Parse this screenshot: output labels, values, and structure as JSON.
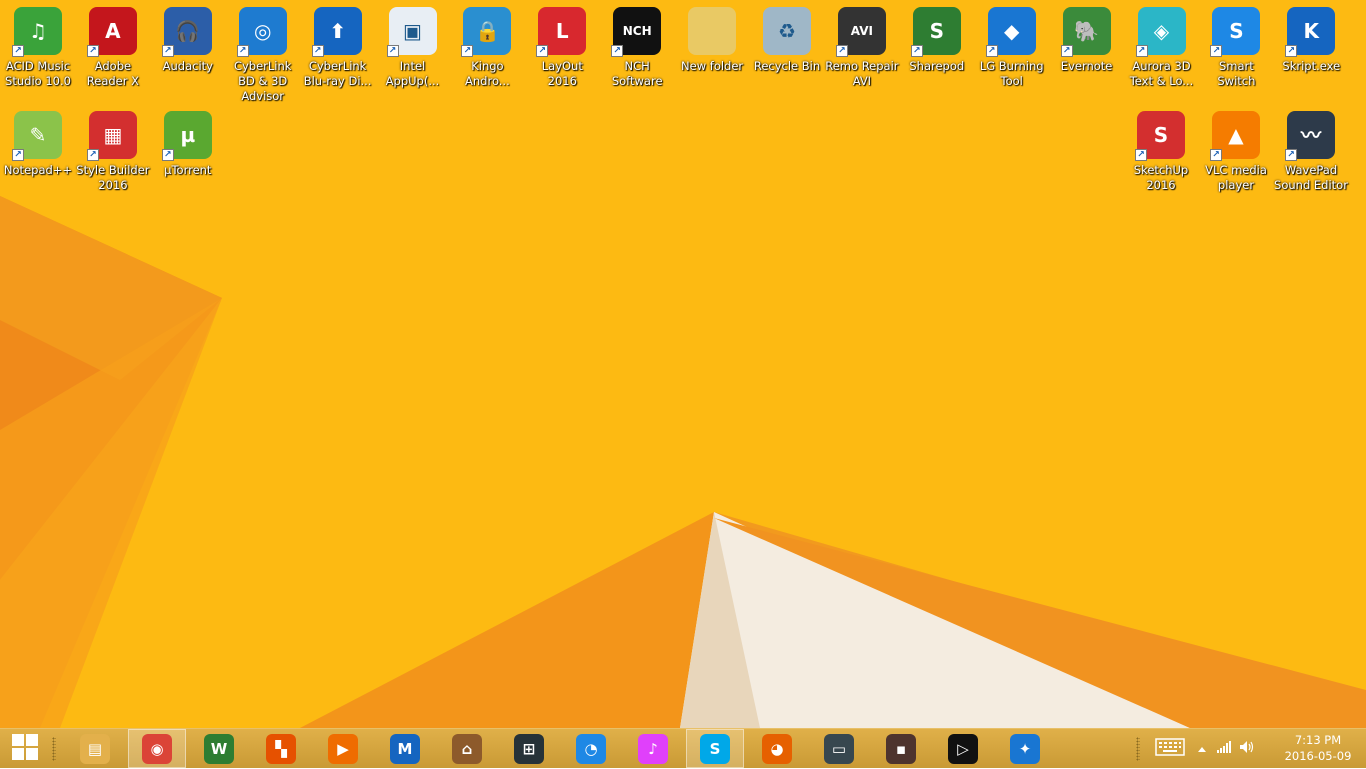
{
  "desktop": {
    "icons": [
      {
        "label": "ACID Music Studio 10.0",
        "icon": "acid-music-icon",
        "glyph": "♫",
        "color": "#3aa33a"
      },
      {
        "label": "Adobe Reader X",
        "icon": "adobe-reader-icon",
        "glyph": "A",
        "color": "#c4161c"
      },
      {
        "label": "Audacity",
        "icon": "audacity-icon",
        "glyph": "🎧",
        "color": "#2c5ea8"
      },
      {
        "label": "CyberLink BD & 3D Advisor",
        "icon": "cyberlink-bd-advisor-icon",
        "glyph": "◎",
        "color": "#1e7bd0"
      },
      {
        "label": "CyberLink Blu-ray Di...",
        "icon": "cyberlink-bluray-icon",
        "glyph": "⬆",
        "color": "#1565c0"
      },
      {
        "label": "Intel AppUp(...",
        "icon": "intel-appup-icon",
        "glyph": "▣",
        "color": "#e8eef4"
      },
      {
        "label": "Kingo Andro...",
        "icon": "kingo-android-icon",
        "glyph": "🔒",
        "color": "#2a8fd0"
      },
      {
        "label": "LayOut 2016",
        "icon": "layout-icon",
        "glyph": "L",
        "color": "#d8282e"
      },
      {
        "label": "NCH Software",
        "icon": "nch-software-icon",
        "glyph": "NCH",
        "color": "#111111"
      },
      {
        "label": "New folder",
        "icon": "folder-icon",
        "glyph": "",
        "color": "#e9c964"
      },
      {
        "label": "Recycle Bin",
        "icon": "recycle-bin-icon",
        "glyph": "♻",
        "color": "#9fb7c7"
      },
      {
        "label": "Remo Repair AVI",
        "icon": "remo-repair-avi-icon",
        "glyph": "AVI",
        "color": "#333333"
      },
      {
        "label": "Sharepod",
        "icon": "sharepod-icon",
        "glyph": "S",
        "color": "#2e7d32"
      },
      {
        "label": "LG Burning Tool",
        "icon": "lg-burning-tool-icon",
        "glyph": "◆",
        "color": "#1976d2"
      },
      {
        "label": "Evernote",
        "icon": "evernote-icon",
        "glyph": "🐘",
        "color": "#3b8b3b"
      },
      {
        "label": "Aurora 3D Text & Lo...",
        "icon": "aurora-3d-icon",
        "glyph": "◈",
        "color": "#2bb6c7"
      },
      {
        "label": "Smart Switch",
        "icon": "smart-switch-icon",
        "glyph": "S",
        "color": "#1e88e5"
      },
      {
        "label": "Skript.exe",
        "icon": "skript-icon",
        "glyph": "K",
        "color": "#1565c0"
      },
      {
        "label": "Notepad++",
        "icon": "notepad-plus-plus-icon",
        "glyph": "✎",
        "color": "#8bc34a"
      },
      {
        "label": "Style Builder 2016",
        "icon": "style-builder-icon",
        "glyph": "▦",
        "color": "#d32f2f"
      },
      {
        "label": "µTorrent",
        "icon": "utorrent-icon",
        "glyph": "µ",
        "color": "#5aa830"
      },
      {
        "label": "SketchUp 2016",
        "icon": "sketchup-icon",
        "glyph": "S",
        "color": "#d32f2f"
      },
      {
        "label": "VLC media player",
        "icon": "vlc-icon",
        "glyph": "▲",
        "color": "#f57c00"
      },
      {
        "label": "WavePad Sound Editor",
        "icon": "wavepad-icon",
        "glyph": "〰",
        "color": "#2d3a4a"
      }
    ]
  },
  "taskbar": {
    "start_icon": "windows-start-icon",
    "apps": [
      {
        "name": "file-explorer",
        "icon": "file-explorer-icon",
        "glyph": "▤",
        "color": "#e3b04b",
        "active": false
      },
      {
        "name": "chrome",
        "icon": "chrome-icon",
        "glyph": "◉",
        "color": "#db4437",
        "active": true
      },
      {
        "name": "wondershare",
        "icon": "wondershare-icon",
        "glyph": "W",
        "color": "#2e7d32",
        "active": false
      },
      {
        "name": "colorful-app",
        "icon": "colorful-app-icon",
        "glyph": "▚",
        "color": "#e65100",
        "active": false
      },
      {
        "name": "video-player",
        "icon": "video-player-icon",
        "glyph": "▶",
        "color": "#ef6c00",
        "active": false
      },
      {
        "name": "malwarebytes",
        "icon": "malwarebytes-icon",
        "glyph": "M",
        "color": "#1565c0",
        "active": false
      },
      {
        "name": "library",
        "icon": "library-icon",
        "glyph": "⌂",
        "color": "#8d5a2b",
        "active": false
      },
      {
        "name": "film-app",
        "icon": "film-app-icon",
        "glyph": "⊞",
        "color": "#263238",
        "active": false
      },
      {
        "name": "bird-app",
        "icon": "bird-app-icon",
        "glyph": "◔",
        "color": "#1e88e5",
        "active": false
      },
      {
        "name": "itunes",
        "icon": "itunes-icon",
        "glyph": "♪",
        "color": "#e040fb",
        "active": false
      },
      {
        "name": "skype",
        "icon": "skype-icon",
        "glyph": "S",
        "color": "#00a8e8",
        "active": true
      },
      {
        "name": "firefox",
        "icon": "firefox-icon",
        "glyph": "◕",
        "color": "#e66000",
        "active": false
      },
      {
        "name": "remote-desktop",
        "icon": "remote-desktop-icon",
        "glyph": "▭",
        "color": "#37474f",
        "active": false
      },
      {
        "name": "hypercam",
        "icon": "hypercam-icon",
        "glyph": "▪",
        "color": "#4e342e",
        "active": false
      },
      {
        "name": "media-player",
        "icon": "media-player-icon",
        "glyph": "▷",
        "color": "#111111",
        "active": false
      },
      {
        "name": "safari",
        "icon": "safari-icon",
        "glyph": "✦",
        "color": "#1976d2",
        "active": false
      }
    ],
    "tray": {
      "keyboard_icon": "touch-keyboard-icon",
      "chevron_icon": "show-hidden-icons-icon",
      "network_icon": "network-signal-icon",
      "volume_icon": "volume-icon",
      "time": "7:13 PM",
      "date": "2016-05-09"
    }
  }
}
